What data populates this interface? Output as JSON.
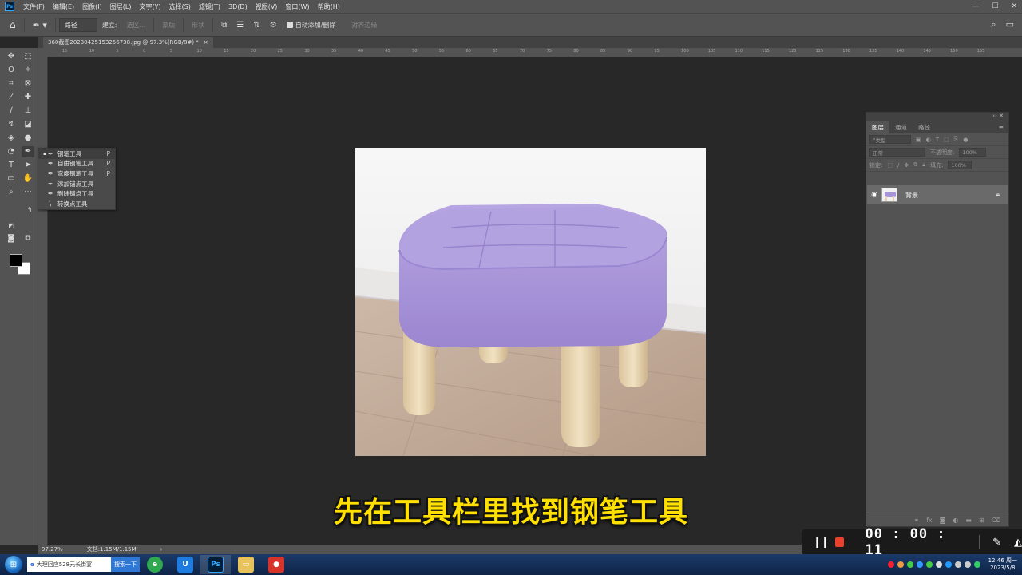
{
  "app": {
    "logo": "Ps",
    "menus": [
      "文件(F)",
      "编辑(E)",
      "图像(I)",
      "图层(L)",
      "文字(Y)",
      "选择(S)",
      "滤镜(T)",
      "3D(D)",
      "视图(V)",
      "窗口(W)",
      "帮助(H)"
    ],
    "window_controls": [
      "—",
      "☐",
      "✕"
    ]
  },
  "options": {
    "mode": "路径",
    "make_label": "建立:",
    "selection": "选区...",
    "mask": "蒙版",
    "shape": "形状",
    "auto_add_delete": "自动添加/删除",
    "align_edges": "对齐边缘"
  },
  "document": {
    "tab_title": "360截图20230425153256738.jpg @ 97.3%(RGB/8#) *",
    "close": "×"
  },
  "ruler_labels": [
    "15",
    "10",
    "5",
    "0",
    "5",
    "10",
    "15",
    "20",
    "25",
    "30",
    "35",
    "40",
    "45",
    "50",
    "55",
    "60",
    "65",
    "70",
    "75",
    "80",
    "85",
    "90",
    "95",
    "100",
    "105",
    "110",
    "115",
    "120",
    "125",
    "130",
    "135",
    "140",
    "145",
    "150",
    "155"
  ],
  "flyout": {
    "items": [
      {
        "label": "钢笔工具",
        "key": "P",
        "active": true
      },
      {
        "label": "自由钢笔工具",
        "key": "P"
      },
      {
        "label": "弯度钢笔工具",
        "key": "P"
      },
      {
        "label": "添加锚点工具",
        "key": ""
      },
      {
        "label": "删除锚点工具",
        "key": ""
      },
      {
        "label": "转换点工具",
        "key": ""
      }
    ]
  },
  "layers_panel": {
    "tabs": [
      "图层",
      "通道",
      "路径"
    ],
    "filter_kind": "类型",
    "blend_mode": "正常",
    "opacity_label": "不透明度:",
    "opacity_value": "100%",
    "lock_label": "锁定:",
    "fill_label": "填充:",
    "fill_value": "100%",
    "layer_name": "背景"
  },
  "status": {
    "zoom": "97.27%",
    "doc_size": "文档:1.15M/1.15M",
    "arrow": "›"
  },
  "subtitle": "先在工具栏里找到钢笔工具",
  "recorder": {
    "time": "00 : 00 : 11"
  },
  "taskbar": {
    "search_text": "大理回应528元长街宴",
    "search_button": "搜索一下",
    "clock_time": "12:46 周一",
    "clock_date": "2023/5/8"
  },
  "colors": {
    "subtitle": "#ffe000",
    "stop": "#e8412c",
    "ps_blue": "#31a8ff"
  }
}
